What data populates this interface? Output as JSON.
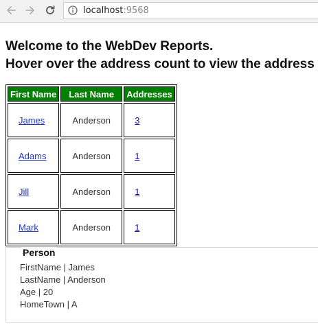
{
  "browser": {
    "url_host": "localhost",
    "url_port": ":9568"
  },
  "page": {
    "heading_line1": "Welcome to the WebDev Reports.",
    "heading_line2": "Hover over the address count to view the address"
  },
  "table": {
    "headers": [
      "First Name",
      "Last Name",
      "Addresses"
    ],
    "rows": [
      {
        "first": "James",
        "last": "Anderson",
        "addresses": "3"
      },
      {
        "first": "Adams",
        "last": "Anderson",
        "addresses": "1"
      },
      {
        "first": "Jill",
        "last": "Anderson",
        "addresses": "1"
      },
      {
        "first": "Mark",
        "last": "Anderson",
        "addresses": "1"
      }
    ]
  },
  "person": {
    "title": "Person",
    "lines": [
      "FirstName | James",
      "LastName | Anderson",
      "Age | 20",
      "HomeTown | A"
    ]
  },
  "colors": {
    "header_bg": "#008000",
    "link": "#1a0dab"
  }
}
